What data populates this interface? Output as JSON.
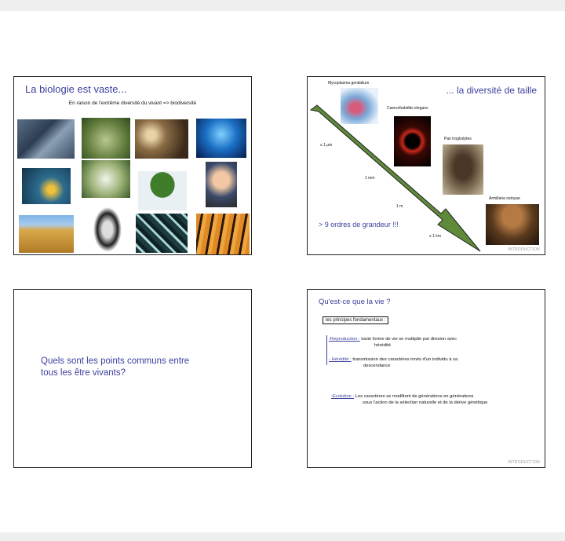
{
  "slide1": {
    "title": "La biologie est vaste...",
    "subtitle": "En raison de l'extrême diversité du vivant => biodiversité"
  },
  "slide2": {
    "title": "... la diversité de taille",
    "organisms": [
      "Mycoplasma genitalium",
      "Caenorhabditis elegans",
      "Pan troglodytes",
      "Armillaria ostoyae"
    ],
    "scales": [
      "≤ 1 µm",
      "1 mm",
      "1 m",
      "≥ 1 km"
    ],
    "orders": "> 9 ordres de grandeur !!!",
    "footer": "INTRODUCTION"
  },
  "slide3": {
    "question_line1": "Quels sont les points communs entre",
    "question_line2": "tous les être vivants?"
  },
  "slide4": {
    "title": "Qu'est-ce que la vie ?",
    "box": "les principes fondamentaux :",
    "reproduction_label": "-Reproduction :",
    "reproduction_text1": "toute forme de vie se multiplie par division avec",
    "reproduction_text2": "hérédité",
    "heredite_label": "- Hérédité :",
    "heredite_text1": "transmission des caractères innés d'un individu à sa",
    "heredite_text2": "descendance",
    "evolution_label": "-Evolution :",
    "evolution_text1": "Les caractères se modifient de générations en générations",
    "evolution_text2": "sous l'action de la sélection naturelle et de la dérive génétique",
    "footer": "INTRODUCTION"
  }
}
